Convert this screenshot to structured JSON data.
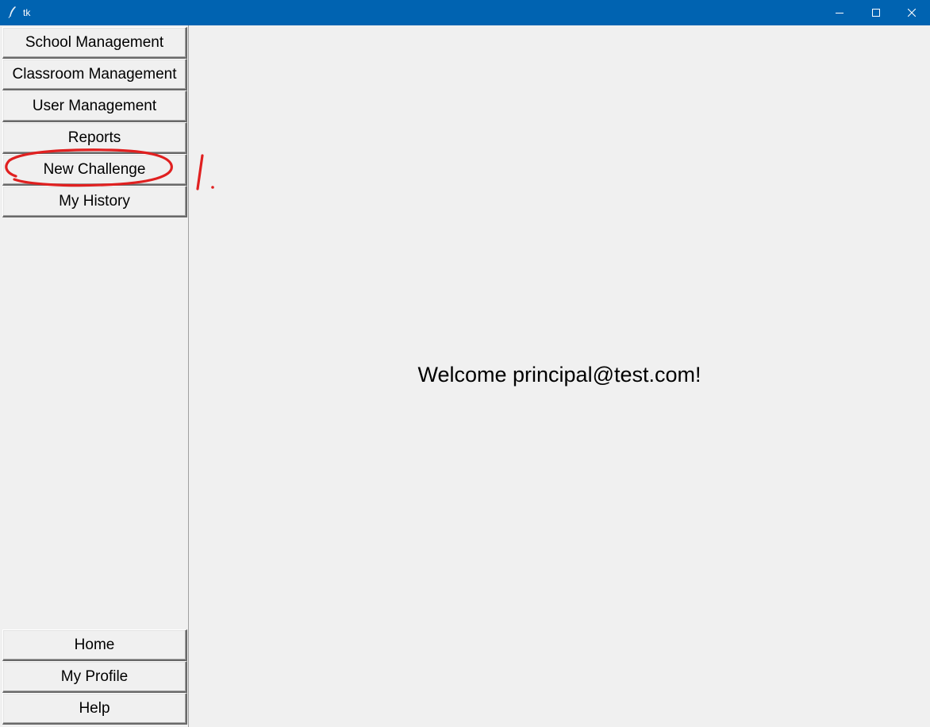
{
  "window": {
    "title": "tk",
    "controls": {
      "minimize_icon": "minimize-icon",
      "maximize_icon": "maximize-icon",
      "close_icon": "close-icon"
    },
    "titlebar_color": "#0063b1"
  },
  "sidebar": {
    "top_items": [
      {
        "label": "School Management"
      },
      {
        "label": "Classroom Management"
      },
      {
        "label": "User Management"
      },
      {
        "label": "Reports"
      },
      {
        "label": "New Challenge"
      },
      {
        "label": "My History"
      }
    ],
    "bottom_items": [
      {
        "label": "Home"
      },
      {
        "label": "My Profile"
      },
      {
        "label": "Help"
      }
    ]
  },
  "main": {
    "welcome_text": "Welcome principal@test.com!"
  },
  "annotation": {
    "color": "#e02020",
    "marker_text": "1."
  }
}
